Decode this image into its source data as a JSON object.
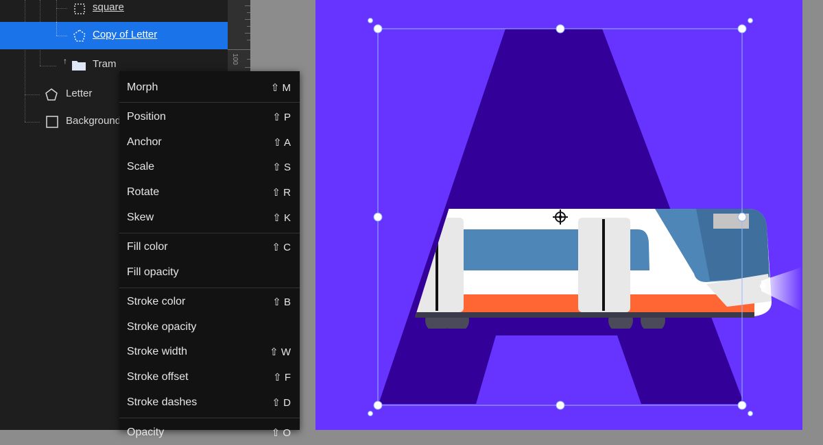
{
  "layers": {
    "items": [
      {
        "label": "square",
        "icon": "square-dashed-icon",
        "selected": false
      },
      {
        "label": "Copy of Letter",
        "icon": "pentagon-dashed-icon",
        "selected": true
      },
      {
        "label": "Tram",
        "icon": "folder-icon",
        "selected": false
      },
      {
        "label": "Letter",
        "icon": "pentagon-icon",
        "selected": false
      },
      {
        "label": "Background",
        "icon": "square-icon",
        "selected": false
      }
    ]
  },
  "ruler": {
    "mark": "100"
  },
  "context_menu": {
    "items": [
      {
        "label": "Morph",
        "shortcut": "⇧ M"
      },
      {
        "label": "Position",
        "shortcut": "⇧ P"
      },
      {
        "label": "Anchor",
        "shortcut": "⇧ A"
      },
      {
        "label": "Scale",
        "shortcut": "⇧ S"
      },
      {
        "label": "Rotate",
        "shortcut": "⇧ R"
      },
      {
        "label": "Skew",
        "shortcut": "⇧ K"
      },
      {
        "label": "Fill color",
        "shortcut": "⇧ C"
      },
      {
        "label": "Fill opacity",
        "shortcut": ""
      },
      {
        "label": "Stroke color",
        "shortcut": "⇧ B"
      },
      {
        "label": "Stroke opacity",
        "shortcut": ""
      },
      {
        "label": "Stroke width",
        "shortcut": "⇧ W"
      },
      {
        "label": "Stroke offset",
        "shortcut": "⇧ F"
      },
      {
        "label": "Stroke dashes",
        "shortcut": "⇧ D"
      },
      {
        "label": "Opacity",
        "shortcut": "⇧ O"
      }
    ]
  },
  "colors": {
    "panel_bg": "#1e1e1e",
    "selection": "#1a73e8",
    "artboard_bg": "#6633ff",
    "letter": "#330099",
    "tram_orange": "#ff6633",
    "tram_blue": "#4f86b8"
  }
}
